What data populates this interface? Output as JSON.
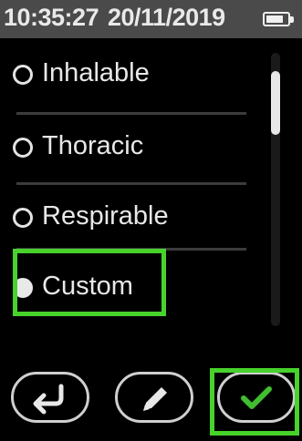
{
  "status": {
    "time": "10:35:27",
    "date": "20/11/2019",
    "battery_icon": "battery-icon"
  },
  "options": [
    {
      "label": "Inhalable",
      "selected": false
    },
    {
      "label": "Thoracic",
      "selected": false
    },
    {
      "label": "Respirable",
      "selected": false
    },
    {
      "label": "Custom",
      "selected": true
    }
  ],
  "buttons": [
    {
      "icon": "return-arrow-icon"
    },
    {
      "icon": "pencil-icon"
    },
    {
      "icon": "checkmark-icon",
      "color": "#3fbf2e"
    }
  ],
  "colors": {
    "highlight": "#47d22c",
    "status_bar": "#4a4a4a",
    "checkmark": "#3fbf2e"
  }
}
